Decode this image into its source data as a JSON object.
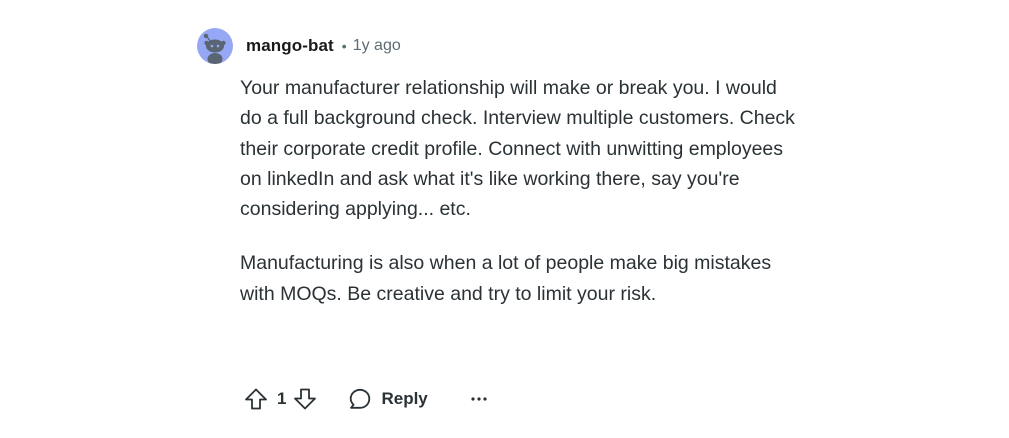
{
  "comment": {
    "author": "mango-bat",
    "separator": "•",
    "time_ago": "1y ago",
    "paragraphs": [
      "Your manufacturer relationship will make or break you. I would do a full background check. Interview multiple customers. Check their corporate credit profile. Connect with unwitting employees on linkedIn and ask what it's like working there, say you're considering applying... etc.",
      "Manufacturing is also when a lot of people make big mistakes with MOQs. Be creative and try to limit your risk."
    ],
    "score": "1",
    "reply_label": "Reply",
    "more_label": "···"
  },
  "colors": {
    "avatar_background": "#96a8f5",
    "avatar_figure": "#5a6573",
    "text": "#2a3236",
    "muted": "#5c6c74"
  },
  "icons": {
    "avatar": "reddit-snoo-icon",
    "upvote": "upvote-arrow-icon",
    "downvote": "downvote-arrow-icon",
    "reply": "speech-bubble-icon",
    "more": "more-horizontal-icon"
  }
}
